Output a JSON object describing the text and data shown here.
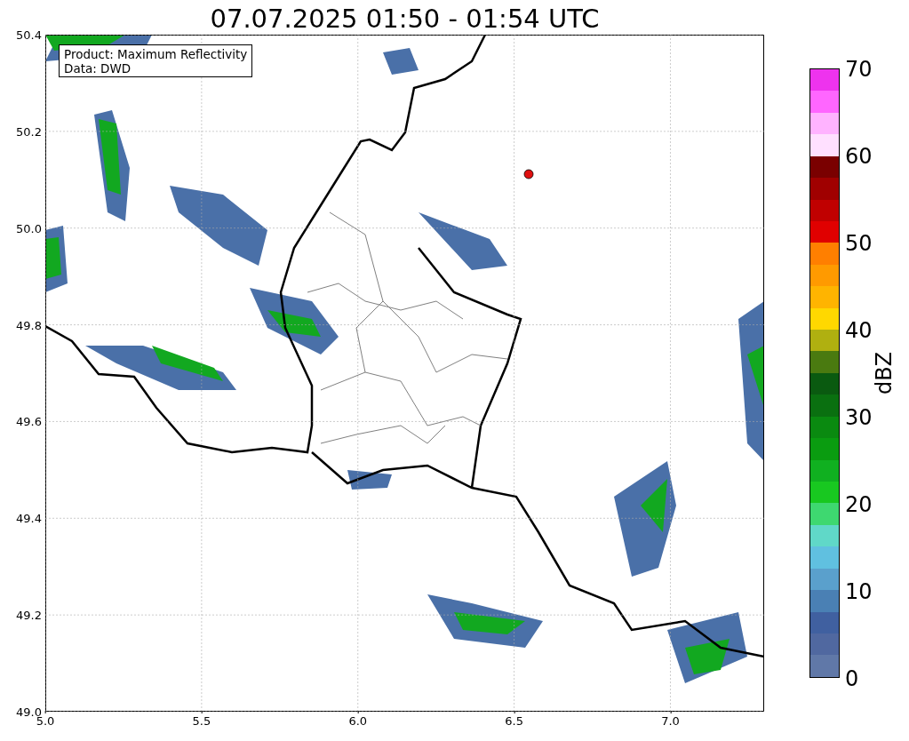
{
  "title": "07.07.2025 01:50 - 01:54 UTC",
  "legend": [
    "Product: Maximum Reflectivity",
    "Data: DWD"
  ],
  "axes": {
    "yticks": [
      "50.4",
      "50.2",
      "50.0",
      "49.8",
      "49.6",
      "49.4",
      "49.2",
      "49.0"
    ],
    "xticks": [
      "5.0",
      "5.5",
      "6.0",
      "6.5",
      "7.0"
    ]
  },
  "colorbar": {
    "label": "dBZ",
    "ticks": [
      "70",
      "60",
      "50",
      "40",
      "30",
      "20",
      "10",
      "0"
    ],
    "bands": [
      {
        "color": "#ee33ee"
      },
      {
        "color": "#ff66ff"
      },
      {
        "color": "#ffb3ff"
      },
      {
        "color": "#ffe0ff"
      },
      {
        "color": "#7a0000"
      },
      {
        "color": "#a00000"
      },
      {
        "color": "#c00000"
      },
      {
        "color": "#e00000"
      },
      {
        "color": "#ff7f00"
      },
      {
        "color": "#ff9a00"
      },
      {
        "color": "#ffb400"
      },
      {
        "color": "#ffd800"
      },
      {
        "color": "#b0b010"
      },
      {
        "color": "#4a7a10"
      },
      {
        "color": "#0a5a10"
      },
      {
        "color": "#0a7010"
      },
      {
        "color": "#0a8a10"
      },
      {
        "color": "#0a9c10"
      },
      {
        "color": "#10b020"
      },
      {
        "color": "#18c820"
      },
      {
        "color": "#3ed870"
      },
      {
        "color": "#60d8c8"
      },
      {
        "color": "#60c0e0"
      },
      {
        "color": "#5aa0cc"
      },
      {
        "color": "#4a80b4"
      },
      {
        "color": "#4060a0"
      },
      {
        "color": "#5068a0"
      },
      {
        "color": "#6078a8"
      }
    ]
  }
}
